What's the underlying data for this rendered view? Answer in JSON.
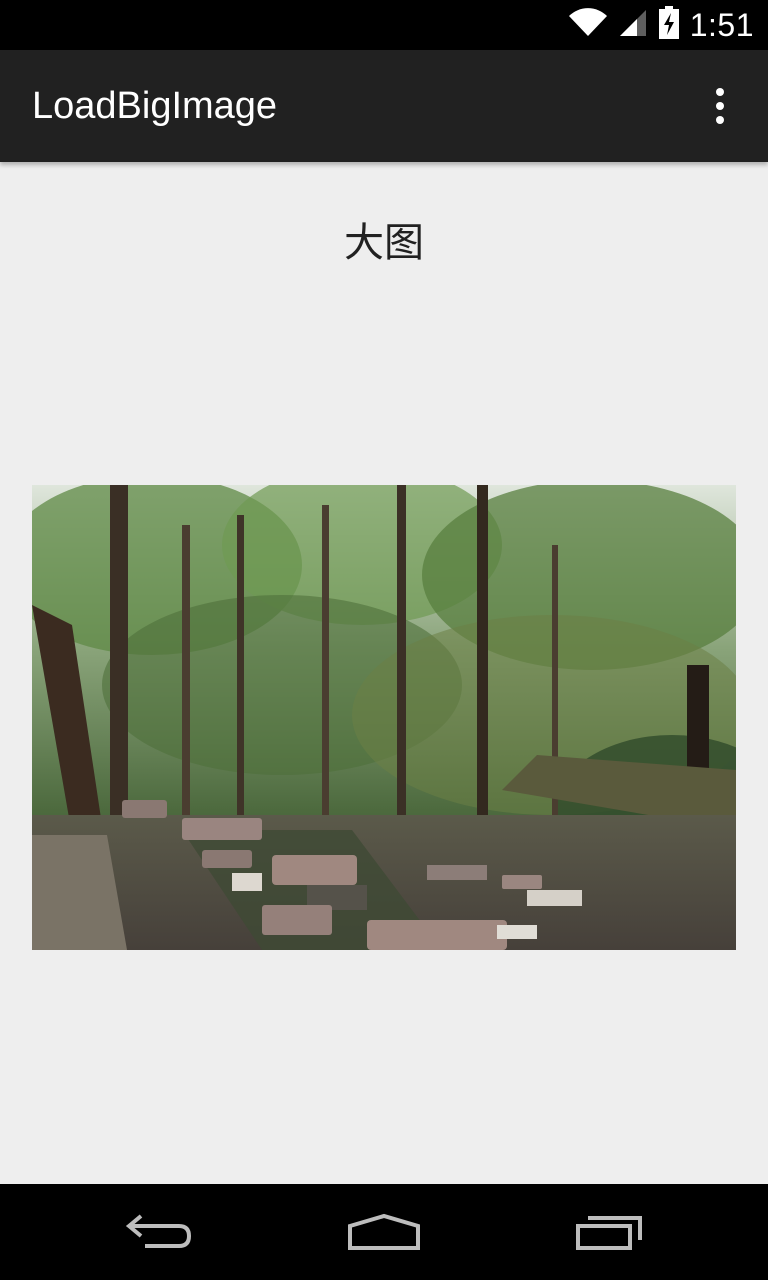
{
  "status_bar": {
    "time": "1:51",
    "icons": [
      "wifi-icon",
      "cell-signal-icon",
      "battery-charging-icon"
    ]
  },
  "action_bar": {
    "title": "LoadBigImage",
    "overflow_icon": "more-vert-icon"
  },
  "content": {
    "heading": "大图",
    "image": "forest-park-photo"
  },
  "navigation_bar": {
    "buttons": [
      "back-icon",
      "home-icon",
      "recents-icon"
    ]
  },
  "colors": {
    "action_bar": "#212121",
    "background": "#eeeeee",
    "text": "#212121"
  }
}
